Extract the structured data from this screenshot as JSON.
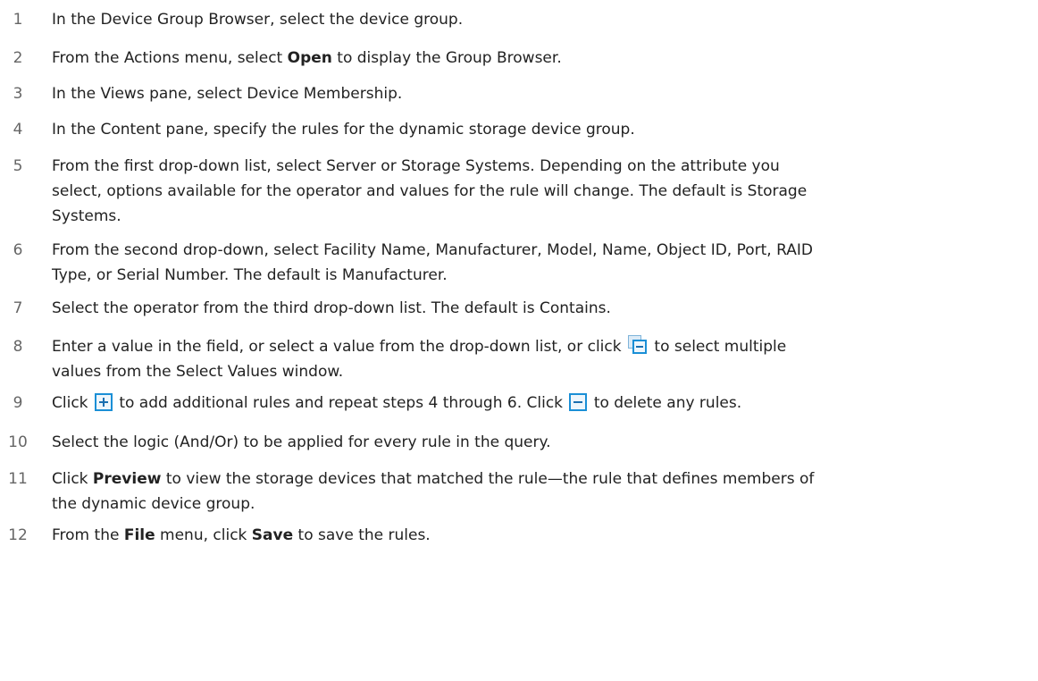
{
  "steps": [
    {
      "num": "1",
      "parts": [
        {
          "t": "In the Device Group Browser, select the device group."
        }
      ]
    },
    {
      "num": "2",
      "parts": [
        {
          "t": "From the Actions menu, select "
        },
        {
          "b": "Open"
        },
        {
          "t": " to display the Group Browser."
        }
      ]
    },
    {
      "num": "3",
      "parts": [
        {
          "t": "In the Views pane, select Device Membership."
        }
      ]
    },
    {
      "num": "4",
      "parts": [
        {
          "t": "In the Content pane, specify the rules for the dynamic storage device group."
        }
      ]
    },
    {
      "num": "5",
      "parts": [
        {
          "t": "From the first drop-down list, select Server or Storage Systems. Depending on the attribute you"
        },
        {
          "br": true
        },
        {
          "t": "select, options available for the operator and values for the rule will change. The default is Storage"
        },
        {
          "br": true
        },
        {
          "t": "Systems."
        }
      ]
    },
    {
      "num": "6",
      "parts": [
        {
          "t": "From the second drop-down, select Facility Name, Manufacturer, Model, Name, Object ID, Port, RAID"
        },
        {
          "br": true
        },
        {
          "t": "Type, or Serial Number. The default is Manufacturer."
        }
      ]
    },
    {
      "num": "7",
      "parts": [
        {
          "t": "Select the operator from the third drop-down list. The default is Contains."
        }
      ]
    },
    {
      "num": "8",
      "parts": [
        {
          "t": "Enter a value in the field, or select a value from the drop-down list, or click "
        },
        {
          "icon": "select-multiple-values-icon"
        },
        {
          "t": " to select multiple"
        },
        {
          "br": true
        },
        {
          "t": "values from the Select Values window."
        }
      ]
    },
    {
      "num": "9",
      "parts": [
        {
          "t": "Click "
        },
        {
          "icon": "add-rule-icon"
        },
        {
          "t": " to add additional rules and repeat steps 4 through 6. Click "
        },
        {
          "icon": "delete-rule-icon"
        },
        {
          "t": " to delete any rules."
        }
      ]
    },
    {
      "num": "10",
      "parts": [
        {
          "t": "Select the logic (And/Or) to be applied for every rule in the query."
        }
      ]
    },
    {
      "num": "11",
      "parts": [
        {
          "t": "Click "
        },
        {
          "b": "Preview"
        },
        {
          "t": " to view the storage devices that matched the rule—the rule that defines members of"
        },
        {
          "br": true
        },
        {
          "t": "the dynamic device group."
        }
      ]
    },
    {
      "num": "12",
      "parts": [
        {
          "t": "From the "
        },
        {
          "b": "File"
        },
        {
          "t": " menu, click "
        },
        {
          "b": "Save"
        },
        {
          "t": " to save the rules."
        }
      ]
    }
  ]
}
